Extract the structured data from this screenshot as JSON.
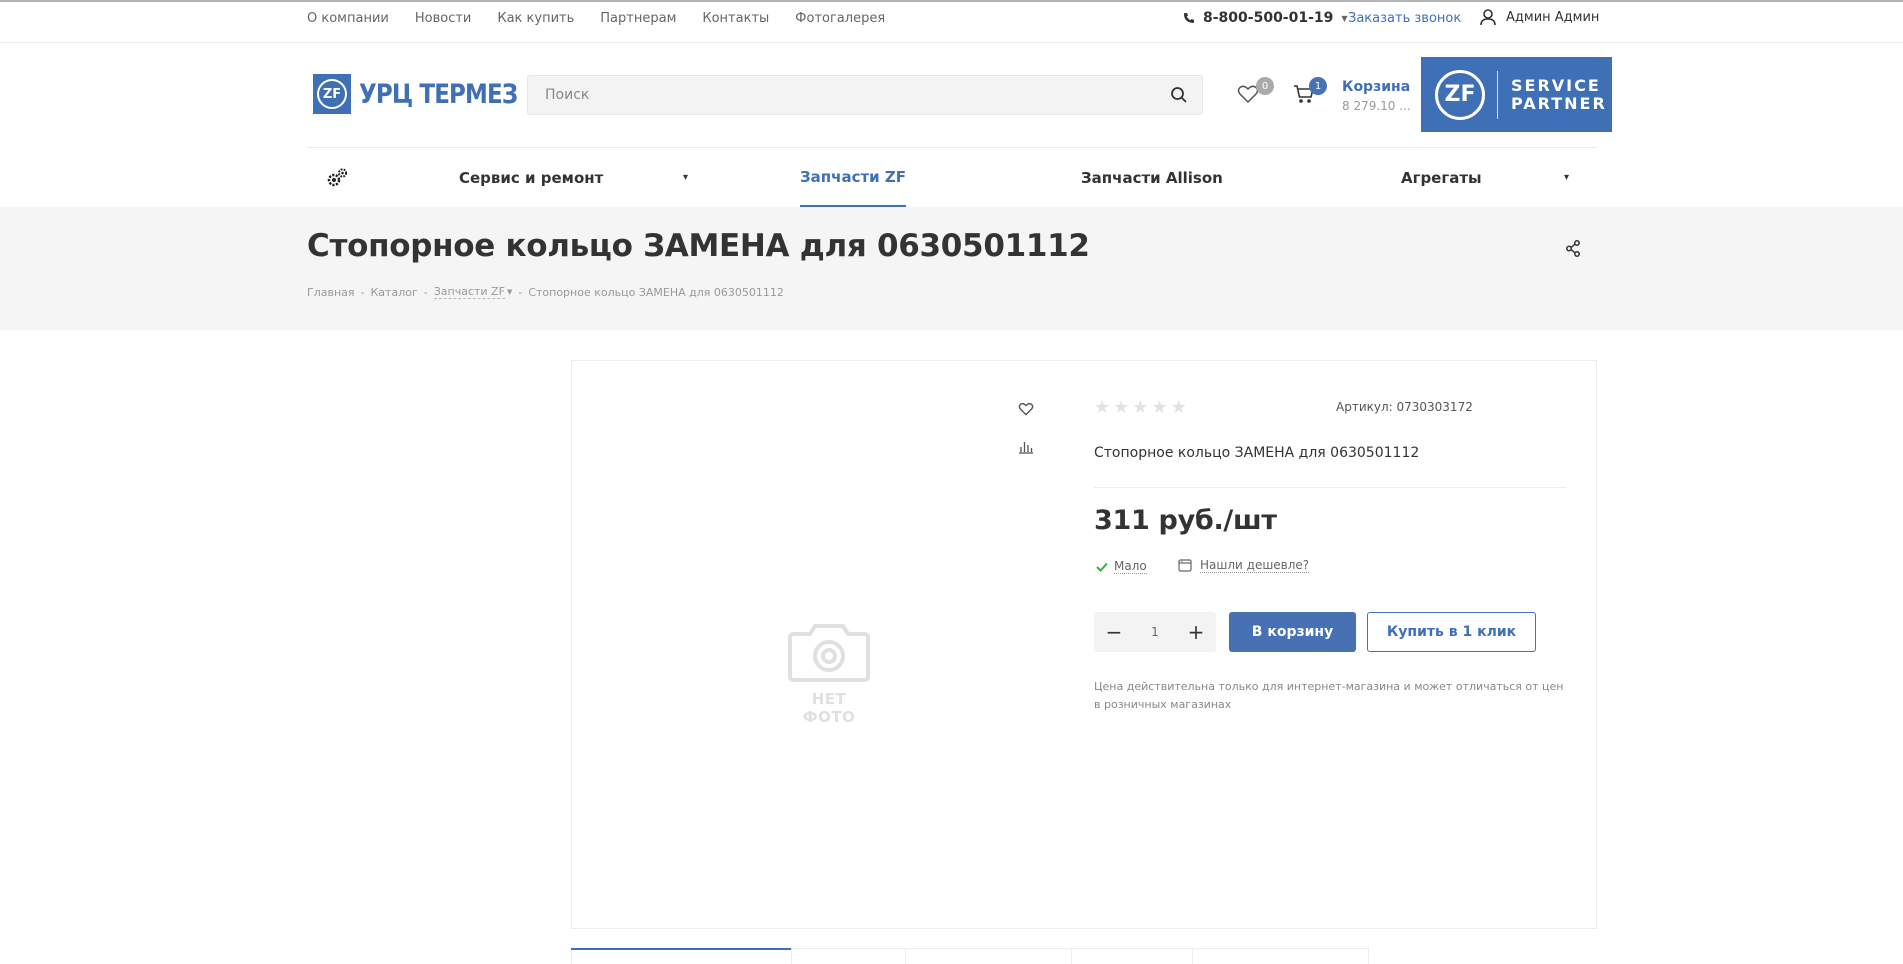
{
  "topnav": [
    "О компании",
    "Новости",
    "Как купить",
    "Партнерам",
    "Контакты",
    "Фотогалерея"
  ],
  "phone": "8-800-500-01-19",
  "callback_label": "Заказать звонок",
  "user_name": "Админ Админ",
  "logo": {
    "badge": "ZF",
    "text": "УРЦ ТЕРМЕЗ"
  },
  "search": {
    "placeholder": "Поиск"
  },
  "favorites_count": "0",
  "cart": {
    "count": "1",
    "label": "Корзина",
    "sum": "8 279.10 ..."
  },
  "zf_banner": {
    "badge": "ZF",
    "line1": "SERVICE",
    "line2": "PARTNER"
  },
  "menu": {
    "items": [
      {
        "label": "Сервис и ремонт"
      },
      {
        "label": "Запчасти ZF"
      },
      {
        "label": "Запчасти Allison"
      },
      {
        "label": "Агрегаты"
      }
    ]
  },
  "page_title": "Стопорное кольцо ЗАМЕНА для 0630501112",
  "breadcrumbs": [
    "Главная",
    "Каталог",
    "Запчасти ZF",
    "Стопорное кольцо ЗАМЕНА для 0630501112"
  ],
  "product": {
    "no_photo": "НЕТ ФОТО",
    "rating": 0,
    "sku_label": "Артикул: 0730303172",
    "description": "Стопорное кольцо ЗАМЕНА для 0630501112",
    "price": "311 руб./шт",
    "stock": "Мало",
    "cheaper": "Нашли дешевле?",
    "quantity": "1",
    "add_to_cart": "В корзину",
    "buy_one_click": "Купить в 1 клик",
    "note": "Цена действительна только для интернет-магазина и может отличаться от цен в розничных магазинах"
  },
  "colors": {
    "accent": "#3f6fb5",
    "button": "#4672b5",
    "band": "#f5f5f5",
    "check": "#2eb82e"
  }
}
